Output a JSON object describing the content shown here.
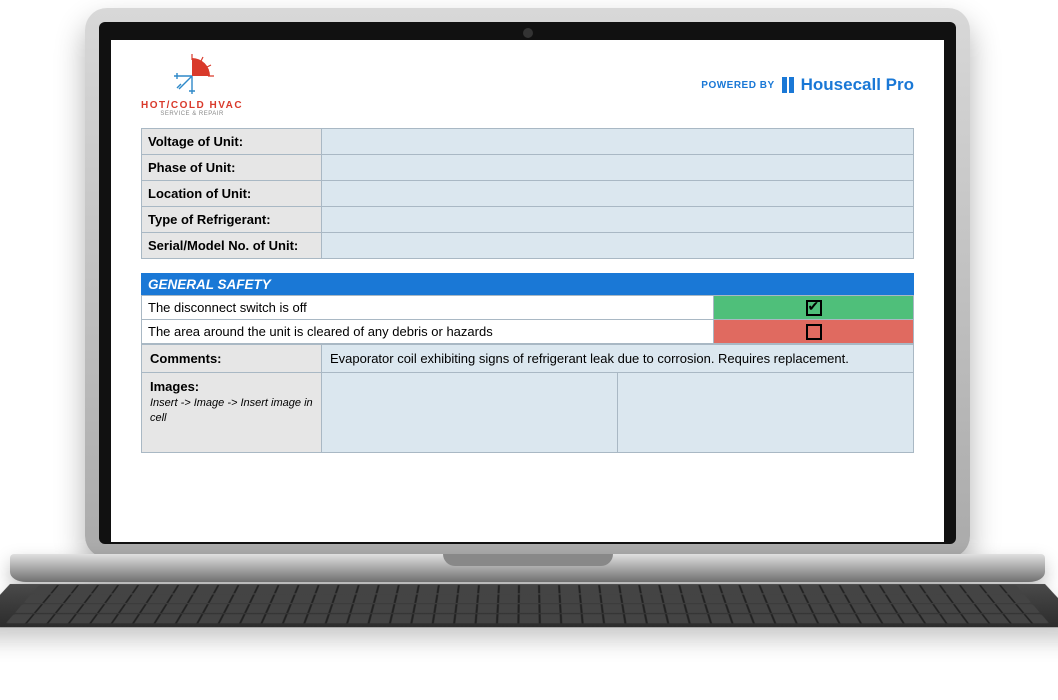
{
  "brand": {
    "name": "HOT/COLD HVAC",
    "tagline": "SERVICE & REPAIR"
  },
  "powered_by": {
    "label": "POWERED BY",
    "name": "Housecall Pro"
  },
  "info_rows": [
    {
      "label": "Voltage of Unit:",
      "value": ""
    },
    {
      "label": "Phase of Unit:",
      "value": ""
    },
    {
      "label": "Location of Unit:",
      "value": ""
    },
    {
      "label": "Type of Refrigerant:",
      "value": ""
    },
    {
      "label": "Serial/Model No. of Unit:",
      "value": ""
    }
  ],
  "section": {
    "title": "GENERAL SAFETY",
    "items": [
      {
        "text": "The disconnect switch is off",
        "checked": true
      },
      {
        "text": "The area around the unit is cleared of any debris or hazards",
        "checked": false
      }
    ]
  },
  "comments": {
    "label": "Comments:",
    "value": "Evaporator coil exhibiting signs of refrigerant leak due to corrosion. Requires replacement."
  },
  "images": {
    "label": "Images:",
    "hint": "Insert ->  Image -> Insert image in cell"
  }
}
